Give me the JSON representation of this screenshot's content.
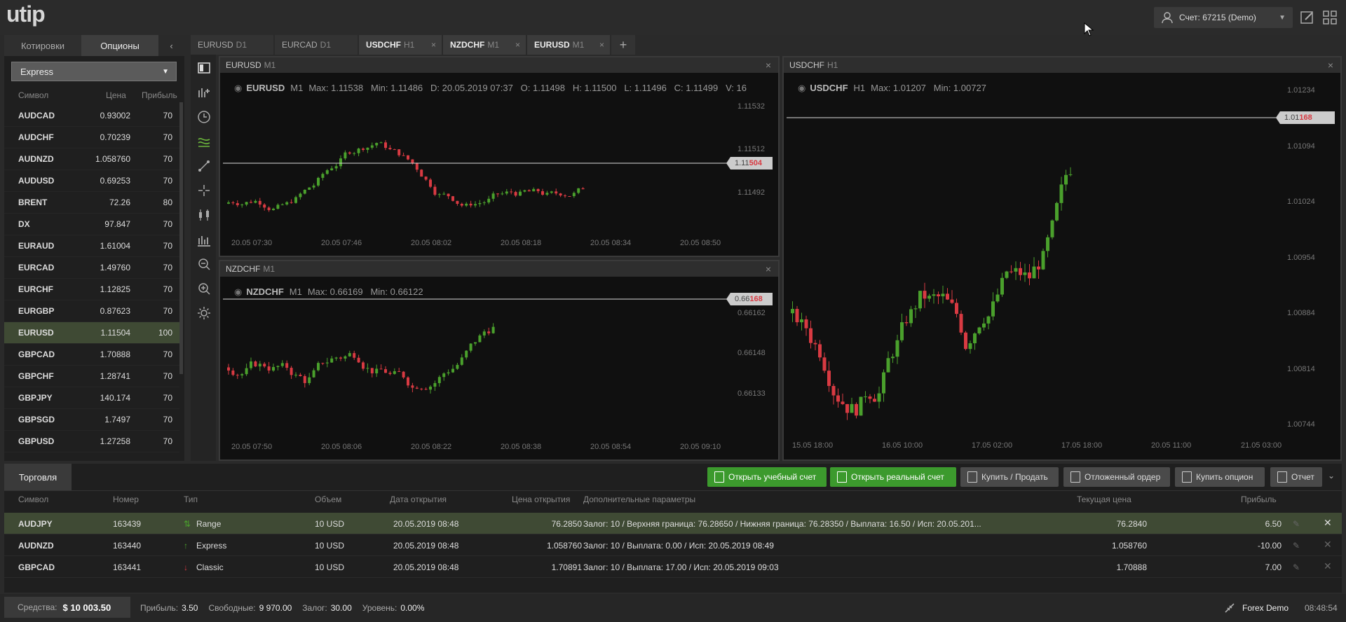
{
  "header": {
    "logo": "utip",
    "account": "Счет: 67215 (Demo)"
  },
  "left_panel": {
    "tabs": [
      "Котировки",
      "Опционы"
    ],
    "mode": "Express",
    "columns": [
      "Символ",
      "Цена",
      "Прибыль"
    ],
    "rows": [
      {
        "s": "AUDCAD",
        "p": "0.93002",
        "f": "70"
      },
      {
        "s": "AUDCHF",
        "p": "0.70239",
        "f": "70"
      },
      {
        "s": "AUDNZD",
        "p": "1.058760",
        "f": "70"
      },
      {
        "s": "AUDUSD",
        "p": "0.69253",
        "f": "70"
      },
      {
        "s": "BRENT",
        "p": "72.26",
        "f": "80"
      },
      {
        "s": "DX",
        "p": "97.847",
        "f": "70"
      },
      {
        "s": "EURAUD",
        "p": "1.61004",
        "f": "70"
      },
      {
        "s": "EURCAD",
        "p": "1.49760",
        "f": "70"
      },
      {
        "s": "EURCHF",
        "p": "1.12825",
        "f": "70"
      },
      {
        "s": "EURGBP",
        "p": "0.87623",
        "f": "70"
      },
      {
        "s": "EURUSD",
        "p": "1.11504",
        "f": "100"
      },
      {
        "s": "GBPCAD",
        "p": "1.70888",
        "f": "70"
      },
      {
        "s": "GBPCHF",
        "p": "1.28741",
        "f": "70"
      },
      {
        "s": "GBPJPY",
        "p": "140.174",
        "f": "70"
      },
      {
        "s": "GBPSGD",
        "p": "1.7497",
        "f": "70"
      },
      {
        "s": "GBPUSD",
        "p": "1.27258",
        "f": "70"
      }
    ],
    "highlight_index": 10
  },
  "chart_tabs": [
    {
      "sym": "EURUSD",
      "tf": "D1"
    },
    {
      "sym": "EURCAD",
      "tf": "D1"
    },
    {
      "sym": "USDCHF",
      "tf": "H1"
    },
    {
      "sym": "NZDCHF",
      "tf": "M1"
    },
    {
      "sym": "EURUSD",
      "tf": "M1"
    }
  ],
  "charts": [
    {
      "title_sym": "EURUSD",
      "title_tf": "M1",
      "info_sym": "EURUSD",
      "info_tf": "M1",
      "info": "Max: 1.11538   Min: 1.11486   D: 20.05.2019 07:37   O: 1.11498   H: 1.11500   L: 1.11496   C: 1.11499   V: 16",
      "y_ticks": [
        "1.11532",
        "1.11512",
        "1.11492"
      ],
      "price_a": "1.11",
      "price_b": "504",
      "x_ticks": [
        "20.05 07:30",
        "20.05 07:46",
        "20.05 08:02",
        "20.05 08:18",
        "20.05 08:34",
        "20.05 08:50"
      ]
    },
    {
      "title_sym": "NZDCHF",
      "title_tf": "M1",
      "info_sym": "NZDCHF",
      "info_tf": "M1",
      "info": "Max: 0.66169   Min: 0.66122",
      "y_ticks": [
        "0.66162",
        "0.66148",
        "0.66133"
      ],
      "price_a": "0.66",
      "price_b": "168",
      "x_ticks": [
        "20.05 07:50",
        "20.05 08:06",
        "20.05 08:22",
        "20.05 08:38",
        "20.05 08:54",
        "20.05 09:10"
      ]
    },
    {
      "title_sym": "USDCHF",
      "title_tf": "H1",
      "info_sym": "USDCHF",
      "info_tf": "H1",
      "info": "Max: 1.01207   Min: 1.00727",
      "y_ticks": [
        "1.01234",
        "1.01094",
        "1.01024",
        "1.00954",
        "1.00884",
        "1.00814",
        "1.00744"
      ],
      "price_a": "1.01",
      "price_b": "168",
      "x_ticks": [
        "15.05 18:00",
        "16.05 10:00",
        "17.05 02:00",
        "17.05 18:00",
        "20.05 11:00",
        "21.05 03:00"
      ]
    }
  ],
  "bottom": {
    "tab": "Торговля",
    "buttons": [
      "Открыть учебный счет",
      "Открыть реальный счет",
      "Купить / Продать",
      "Отложенный ордер",
      "Купить опцион",
      "Отчет"
    ],
    "columns": [
      "Символ",
      "Номер",
      "Тип",
      "Объем",
      "Дата открытия",
      "Цена открытия",
      "Дополнительные параметры",
      "Текущая цена",
      "Прибыль"
    ],
    "rows": [
      {
        "sym": "AUDJPY",
        "num": "163439",
        "type": "Range",
        "vol": "10 USD",
        "date": "20.05.2019 08:48",
        "open": "76.2850",
        "params": "Залог: 10 / Верхняя граница: 76.28650 / Нижняя граница: 76.28350 / Выплата: 16.50 / Исп: 20.05.201...",
        "cur": "76.2840",
        "profit": "6.50"
      },
      {
        "sym": "AUDNZD",
        "num": "163440",
        "type": "Express",
        "vol": "10 USD",
        "date": "20.05.2019 08:48",
        "open": "1.058760",
        "params": "Залог: 10 / Выплата: 0.00 / Исп: 20.05.2019 08:49",
        "cur": "1.058760",
        "profit": "-10.00"
      },
      {
        "sym": "GBPCAD",
        "num": "163441",
        "type": "Classic",
        "vol": "10 USD",
        "date": "20.05.2019 08:48",
        "open": "1.70891",
        "params": "Залог: 10 / Выплата: 17.00 / Исп: 20.05.2019 09:03",
        "cur": "1.70888",
        "profit": "7.00"
      }
    ]
  },
  "status": {
    "funds_label": "Средства:",
    "funds": "$ 10 003.50",
    "profit_label": "Прибыль:",
    "profit": "3.50",
    "free_label": "Свободные:",
    "free": "9 970.00",
    "margin_label": "Залог:",
    "margin": "30.00",
    "level_label": "Уровень:",
    "level": "0.00%",
    "server": "Forex Demo",
    "time": "08:48:54"
  },
  "colors": {
    "up": "#4aa02c",
    "down": "#d83a42",
    "accent": "#3c9a2d"
  }
}
